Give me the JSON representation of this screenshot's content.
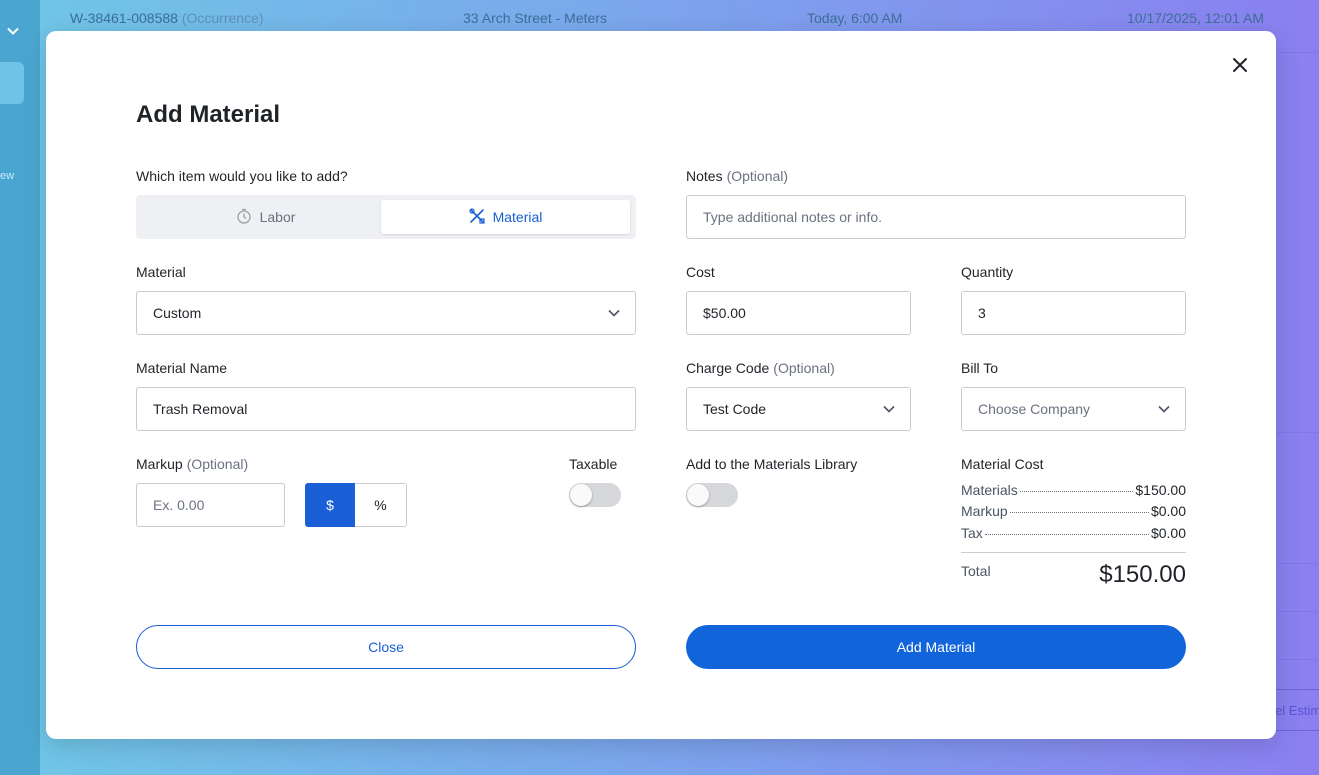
{
  "background": {
    "row": {
      "id": "W-38461-008588",
      "tag": "(Occurrence)",
      "location": "33 Arch Street - Meters",
      "due": "Today, 6:00 AM",
      "created": "10/17/2025, 12:01 AM"
    },
    "sidebar_partial_text": "ew",
    "right_button_partial": "el Estim"
  },
  "modal": {
    "title": "Add Material",
    "item_type": {
      "question": "Which item would you like to add?",
      "options": [
        {
          "label": "Labor",
          "icon": "stopwatch-icon",
          "selected": false
        },
        {
          "label": "Material",
          "icon": "tools-icon",
          "selected": true
        }
      ]
    },
    "notes": {
      "label": "Notes",
      "optional": "(Optional)",
      "placeholder": "Type additional notes or info."
    },
    "material": {
      "label": "Material",
      "value": "Custom"
    },
    "cost": {
      "label": "Cost",
      "value": "$50.00"
    },
    "quantity": {
      "label": "Quantity",
      "value": "3"
    },
    "material_name": {
      "label": "Material Name",
      "value": "Trash Removal"
    },
    "charge_code": {
      "label": "Charge Code",
      "optional": "(Optional)",
      "value": "Test Code"
    },
    "bill_to": {
      "label": "Bill To",
      "placeholder": "Choose Company"
    },
    "markup": {
      "label": "Markup",
      "optional": "(Optional)",
      "placeholder": "Ex. 0.00",
      "unit_dollar": "$",
      "unit_percent": "%",
      "selected_unit": "$"
    },
    "taxable": {
      "label": "Taxable",
      "on": false
    },
    "library": {
      "label": "Add to the Materials Library",
      "on": false
    },
    "material_cost": {
      "label": "Material Cost",
      "rows": [
        {
          "label": "Materials",
          "value": "$150.00"
        },
        {
          "label": "Markup",
          "value": "$0.00"
        },
        {
          "label": "Tax",
          "value": "$0.00"
        }
      ],
      "total_label": "Total",
      "total_value": "$150.00"
    },
    "buttons": {
      "close": "Close",
      "add": "Add Material"
    }
  },
  "colors": {
    "primary": "#1264db",
    "accent": "#1a5fd6",
    "toggle_off": "#d5d7db"
  }
}
